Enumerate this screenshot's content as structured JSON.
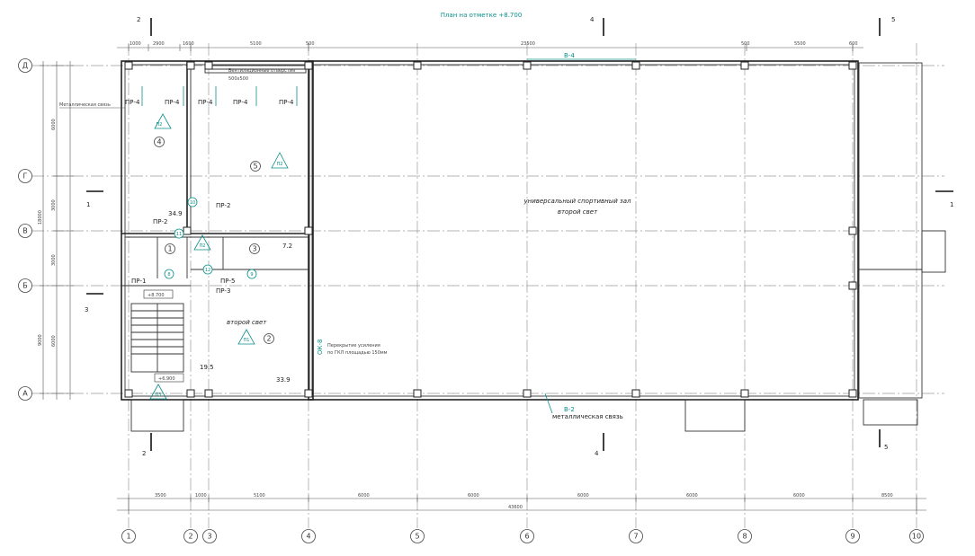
{
  "title": "План на отметке +8.700",
  "axes_letters": [
    "Д",
    "Г",
    "В",
    "Б",
    "А"
  ],
  "axes_numbers": [
    "1",
    "2",
    "3",
    "4",
    "5",
    "6",
    "7",
    "8",
    "9",
    "10"
  ],
  "top_dims": [
    "1000",
    "2900",
    "1600",
    "5100",
    "500",
    "23500",
    "500",
    "5500",
    "600"
  ],
  "bottom_dims": [
    "3500",
    "1000",
    "5100",
    "6000",
    "6000",
    "6000",
    "6000",
    "6000",
    "8500"
  ],
  "bottom_total": "43600",
  "left_dims_outer": [
    "18000",
    "9000"
  ],
  "left_dims_mid": [
    "6000",
    "3000",
    "3000",
    "6000"
  ],
  "beam_labels": {
    "top": "В-4",
    "bottom": "В-2",
    "bottom_note": "металлическая связь",
    "ok": "ОК-8"
  },
  "hall_label": {
    "line1": "универсальный спортивный зал",
    "line2": "второй свет"
  },
  "second_light": "второй свет",
  "metal_tie_note": "Металлическая связь",
  "vent_note": "Вентиляционные отверстия",
  "vent_size": "500х500",
  "beams": [
    "ПР-4",
    "ПР-4",
    "ПР-4",
    "ПР-4",
    "ПР-2",
    "ПР-2",
    "ПР-1",
    "ПР-5",
    "ПР-3"
  ],
  "rooms": [
    "1",
    "2",
    "3",
    "4",
    "5"
  ],
  "room_tags": [
    "П2",
    "П2",
    "П2",
    "П1",
    "П3"
  ],
  "nodes": [
    "10",
    "11",
    "12",
    "8",
    "9"
  ],
  "areas": [
    "34.9",
    "7.2",
    "19.5",
    "33.9"
  ],
  "elev_top": "+8.700",
  "elev_bottom": "+6.900",
  "section_marks": [
    "1",
    "1",
    "2",
    "2",
    "3",
    "4",
    "4",
    "5",
    "5"
  ],
  "hole_note": "Перекрытие усиления",
  "hole_note2": "по ГКЛ площадью 150мм"
}
